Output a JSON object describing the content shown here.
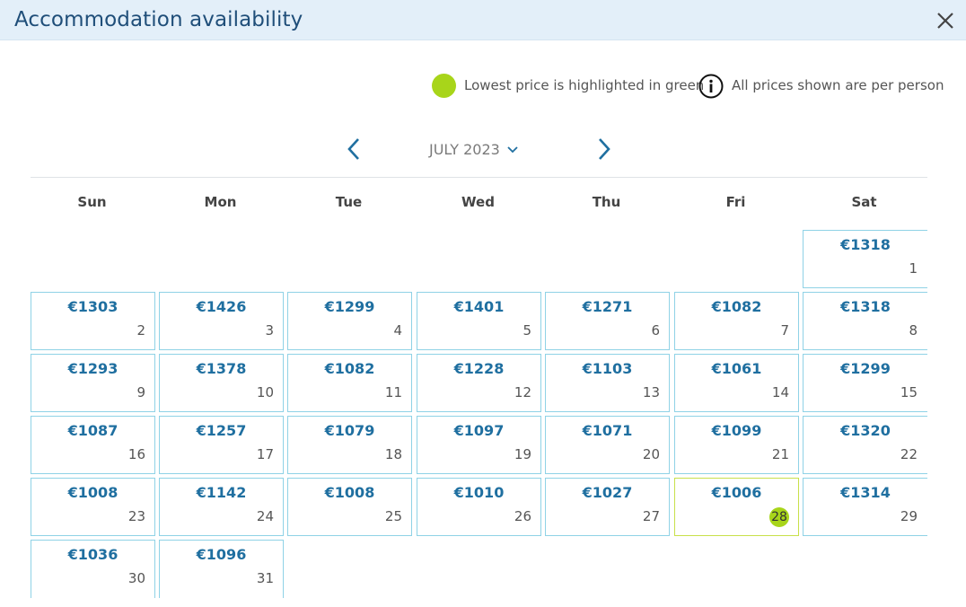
{
  "header": {
    "title": "Accommodation availability"
  },
  "legend": {
    "lowest_text": "Lowest price is highlighted in green",
    "per_person_text": "All prices shown are per person",
    "lowest_color": "#a8d51a"
  },
  "calendar": {
    "month_label": "JULY 2023",
    "weekdays": [
      "Sun",
      "Mon",
      "Tue",
      "Wed",
      "Thu",
      "Fri",
      "Sat"
    ],
    "days": [
      {
        "day": "1",
        "price": "€1318"
      },
      {
        "day": "2",
        "price": "€1303"
      },
      {
        "day": "3",
        "price": "€1426"
      },
      {
        "day": "4",
        "price": "€1299"
      },
      {
        "day": "5",
        "price": "€1401"
      },
      {
        "day": "6",
        "price": "€1271"
      },
      {
        "day": "7",
        "price": "€1082"
      },
      {
        "day": "8",
        "price": "€1318"
      },
      {
        "day": "9",
        "price": "€1293"
      },
      {
        "day": "10",
        "price": "€1378"
      },
      {
        "day": "11",
        "price": "€1082"
      },
      {
        "day": "12",
        "price": "€1228"
      },
      {
        "day": "13",
        "price": "€1103"
      },
      {
        "day": "14",
        "price": "€1061"
      },
      {
        "day": "15",
        "price": "€1299"
      },
      {
        "day": "16",
        "price": "€1087"
      },
      {
        "day": "17",
        "price": "€1257"
      },
      {
        "day": "18",
        "price": "€1079"
      },
      {
        "day": "19",
        "price": "€1097"
      },
      {
        "day": "20",
        "price": "€1071"
      },
      {
        "day": "21",
        "price": "€1099"
      },
      {
        "day": "22",
        "price": "€1320"
      },
      {
        "day": "23",
        "price": "€1008"
      },
      {
        "day": "24",
        "price": "€1142"
      },
      {
        "day": "25",
        "price": "€1008"
      },
      {
        "day": "26",
        "price": "€1010"
      },
      {
        "day": "27",
        "price": "€1027"
      },
      {
        "day": "28",
        "price": "€1006",
        "lowest": true
      },
      {
        "day": "29",
        "price": "€1314"
      },
      {
        "day": "30",
        "price": "€1036"
      },
      {
        "day": "31",
        "price": "€1096"
      }
    ]
  }
}
